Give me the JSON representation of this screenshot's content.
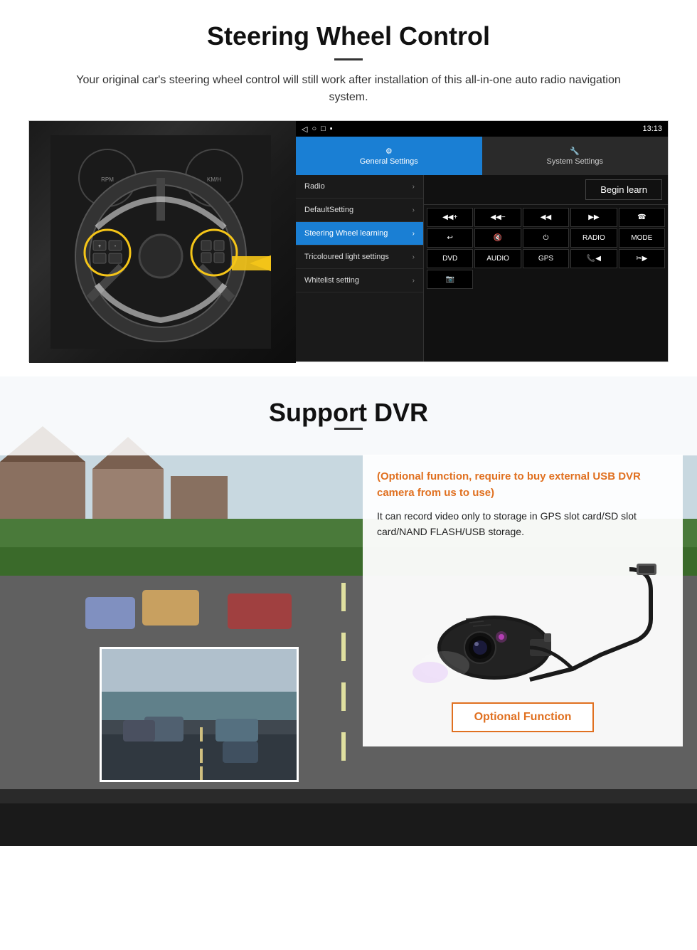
{
  "steering": {
    "title": "Steering Wheel Control",
    "description": "Your original car's steering wheel control will still work after installation of this all-in-one auto radio navigation system.",
    "statusbar": {
      "time": "13:13",
      "nav_back": "◁",
      "nav_home": "○",
      "nav_square": "□",
      "nav_dot": "▪"
    },
    "tabs": {
      "general": "General Settings",
      "system": "System Settings"
    },
    "menu_items": [
      {
        "label": "Radio",
        "active": false
      },
      {
        "label": "DefaultSetting",
        "active": false
      },
      {
        "label": "Steering Wheel learning",
        "active": true
      },
      {
        "label": "Tricoloured light settings",
        "active": false
      },
      {
        "label": "Whitelist setting",
        "active": false
      }
    ],
    "begin_learn": "Begin learn",
    "control_buttons": [
      "◀◀+",
      "◀◀-",
      "◀◀",
      "▶▶",
      "📞",
      "↩",
      "🔇",
      "⏻",
      "RADIO",
      "MODE",
      "DVD",
      "AUDIO",
      "GPS",
      "📞◀◀",
      "✂▶▶",
      "📷"
    ]
  },
  "dvr": {
    "title": "Support DVR",
    "optional_heading": "(Optional function, require to buy external USB DVR camera from us to use)",
    "description": "It can record video only to storage in GPS slot card/SD slot card/NAND FLASH/USB storage.",
    "optional_button": "Optional Function"
  }
}
